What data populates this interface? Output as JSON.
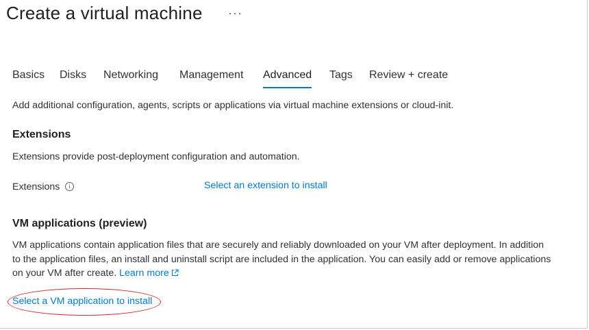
{
  "page": {
    "title": "Create a virtual machine",
    "more_label": "···"
  },
  "tabs": [
    {
      "label": "Basics"
    },
    {
      "label": "Disks"
    },
    {
      "label": "Networking"
    },
    {
      "label": "Management"
    },
    {
      "label": "Advanced",
      "active": true
    },
    {
      "label": "Tags"
    },
    {
      "label": "Review + create"
    }
  ],
  "intro": "Add additional configuration, agents, scripts or applications via virtual machine extensions or cloud-init.",
  "extensions": {
    "heading": "Extensions",
    "description": "Extensions provide post-deployment configuration and automation.",
    "field_label": "Extensions",
    "info_icon": "i",
    "select_link": "Select an extension to install"
  },
  "vm_applications": {
    "heading": "VM applications (preview)",
    "description_line1": "VM applications contain application files that are securely and reliably downloaded on your VM after deployment. In addition",
    "description_line2": "to the application files, an install and uninstall script are included in the application. You can easily add or remove applications",
    "description_line3": "on your VM after create.",
    "learn_more": "Learn more",
    "select_link": "Select a VM application to install"
  },
  "colors": {
    "accent": "#0078d4",
    "highlight_circle": "#d6262a",
    "text": "#323130"
  }
}
